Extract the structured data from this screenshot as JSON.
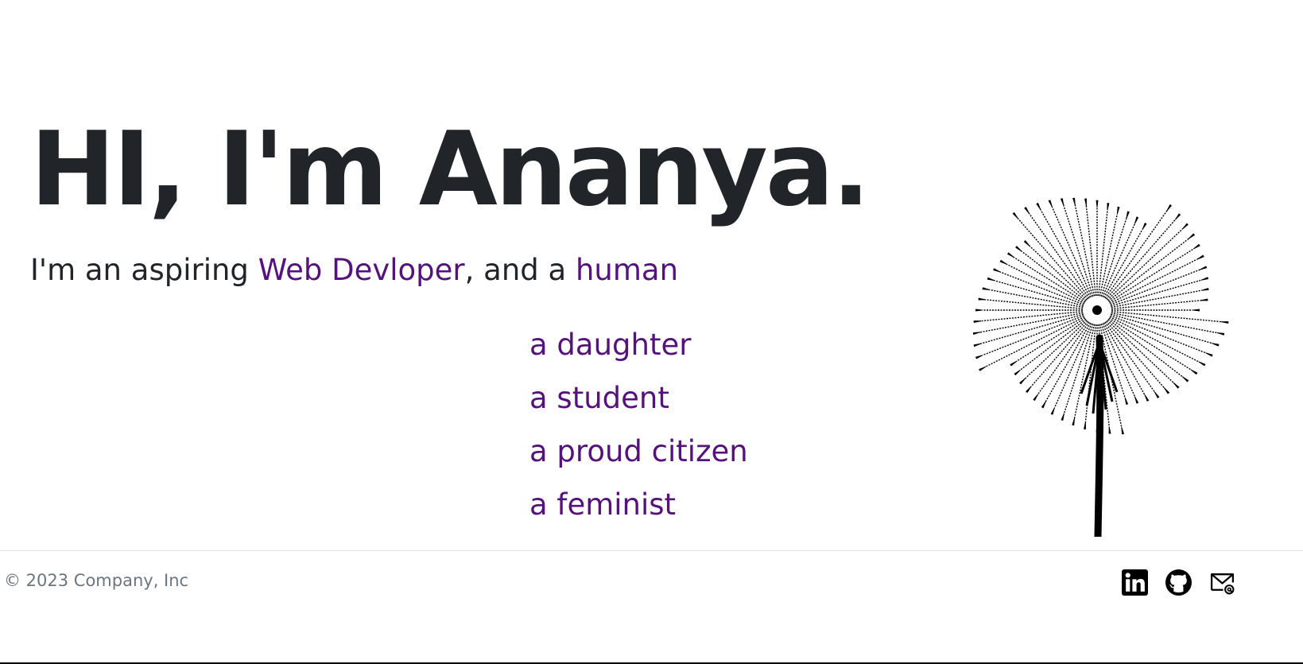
{
  "hero": {
    "title": "HI, I'm Ananya.",
    "tagline_prefix": "I'm an aspiring ",
    "tagline_accent1": "Web Devloper",
    "tagline_middle": ", and a ",
    "tagline_accent2": "human"
  },
  "roles": [
    "a daughter",
    "a student",
    "a proud citizen",
    "a feminist"
  ],
  "footer": {
    "copyright": "© 2023 Company, Inc",
    "social_icons": [
      "linkedin-icon",
      "github-icon",
      "email-icon"
    ]
  },
  "colors": {
    "accent": "#55127a",
    "text": "#212529",
    "muted": "#6c757d",
    "divider": "#dee2e6"
  }
}
